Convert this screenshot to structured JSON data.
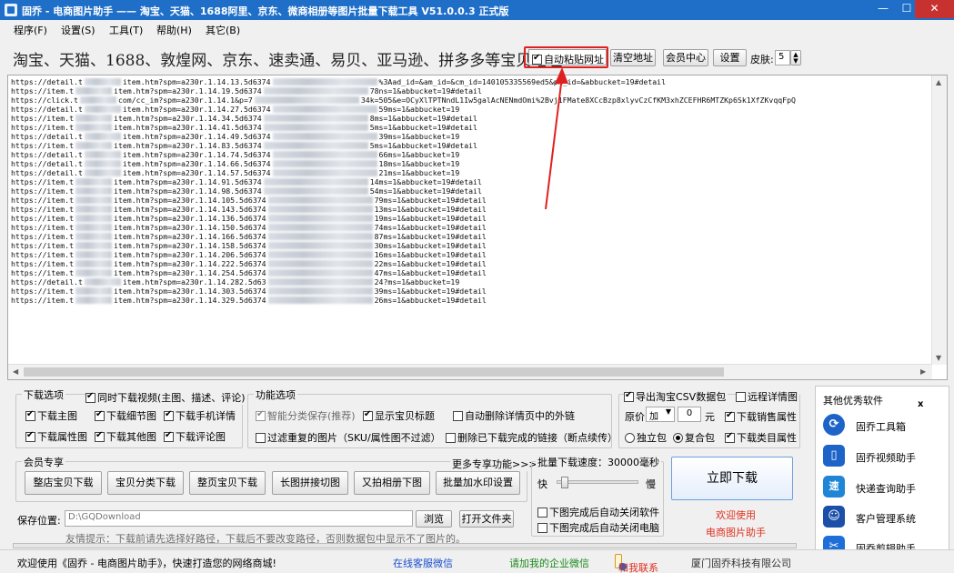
{
  "window": {
    "title": "固乔 - 电商图片助手 —— 淘宝、天猫、1688阿里、京东、微商相册等图片批量下载工具 V51.0.0.3 正式版",
    "min": "—",
    "max": "☐",
    "close": "✕"
  },
  "menu": [
    "程序(F)",
    "设置(S)",
    "工具(T)",
    "帮助(H)",
    "其它(B)"
  ],
  "address": {
    "label": "淘宝、天猫、1688、敦煌网、京东、速卖通、易贝、亚马逊、拼多多等宝贝地址:",
    "auto_paste": "自动粘贴网址",
    "clear": "清空地址",
    "member_center": "会员中心",
    "settings": "设置",
    "skin_label": "皮肤:",
    "skin_value": "5"
  },
  "urls": [
    [
      "https://detail.t",
      "item.htm?spm=a230r.1.14.13.5d6374",
      "%3Aad_id=&am_id=&cm_id=140105335569ed5",
      "&pm_id=&abbucket=19#detail"
    ],
    [
      "https://item.t",
      "item.htm?spm=a230r.1.14.19.5d6374",
      "",
      "78ns=1&abbucket=19#detail"
    ],
    [
      "https://click.t",
      "com/cc_im?spm=a230r.1.14.1&p=7",
      "34k=505&e=OCyXlTPTNndL1Iw5galAcNENmdOmi%2Bvj1FMate8XCcBzp8xly",
      "vCzCfKM3xhZCEFHR6MTZKp6Sk1XfZKvqqFpQ"
    ],
    [
      "https://detail.t",
      "item.htm?spm=a230r.1.14.27.5d6374",
      "",
      "59ms=1&abbucket=19"
    ],
    [
      "https://item.t",
      "item.htm?spm=a230r.1.14.34.5d6374",
      "",
      "8ms=1&abbucket=19#detail"
    ],
    [
      "https://item.t",
      "item.htm?spm=a230r.1.14.41.5d6374",
      "",
      "5ms=1&abbucket=19#detail"
    ],
    [
      "https://detail.t",
      "item.htm?spm=a230r.1.14.49.5d6374",
      "",
      "39ms=1&abbucket=19"
    ],
    [
      "https://item.t",
      "item.htm?spm=a230r.1.14.83.5d6374",
      "",
      "5ms=1&abbucket=19#detail"
    ],
    [
      "https://detail.t",
      "item.htm?spm=a230r.1.14.74.5d6374",
      "",
      "66ms=1&abbucket=19"
    ],
    [
      "https://detail.t",
      "item.htm?spm=a230r.1.14.66.5d6374",
      "",
      "18ms=1&abbucket=19"
    ],
    [
      "https://detail.t",
      "item.htm?spm=a230r.1.14.57.5d6374",
      "",
      "21ms=1&abbucket=19"
    ],
    [
      "https://item.t",
      "item.htm?spm=a230r.1.14.91.5d6374",
      "",
      "14ms=1&abbucket=19#detail"
    ],
    [
      "https://item.t",
      "item.htm?spm=a230r.1.14.98.5d6374",
      "",
      "54ms=1&abbucket=19#detail"
    ],
    [
      "https://item.t",
      "item.htm?spm=a230r.1.14.105.5d6374",
      "",
      "79ms=1&abbucket=19#detail"
    ],
    [
      "https://item.t",
      "item.htm?spm=a230r.1.14.143.5d6374",
      "",
      "13ms=1&abbucket=19#detail"
    ],
    [
      "https://item.t",
      "item.htm?spm=a230r.1.14.136.5d6374",
      "",
      "19ms=1&abbucket=19#detail"
    ],
    [
      "https://item.t",
      "item.htm?spm=a230r.1.14.150.5d6374",
      "",
      "74ms=1&abbucket=19#detail"
    ],
    [
      "https://item.t",
      "item.htm?spm=a230r.1.14.166.5d6374",
      "",
      "87ms=1&abbucket=19#detail"
    ],
    [
      "https://item.t",
      "item.htm?spm=a230r.1.14.158.5d6374",
      "",
      "30ms=1&abbucket=19#detail"
    ],
    [
      "https://item.t",
      "item.htm?spm=a230r.1.14.206.5d6374",
      "",
      "16ms=1&abbucket=19#detail"
    ],
    [
      "https://item.t",
      "item.htm?spm=a230r.1.14.222.5d6374",
      "",
      "22ms=1&abbucket=19#detail"
    ],
    [
      "https://item.t",
      "item.htm?spm=a230r.1.14.254.5d6374",
      "",
      "47ms=1&abbucket=19#detail"
    ],
    [
      "https://detail.t",
      "item.htm?spm=a230r.1.14.282.5d63",
      "",
      "24?ms=1&abbucket=19"
    ],
    [
      "https://item.t",
      "item.htm?spm=a230r.1.14.303.5d6374",
      "",
      "39ms=1&abbucket=19#detail"
    ],
    [
      "https://item.t",
      "item.htm?spm=a230r.1.14.329.5d6374",
      "",
      "26ms=1&abbucket=19#detail"
    ]
  ],
  "download_options": {
    "title": "下载选项",
    "video": "同时下载视频(主图、描述、评论)",
    "main_img": "下载主图",
    "detail_img": "下载细节图",
    "mobile_detail": "下载手机详情",
    "attr_img": "下载属性图",
    "other_img": "下载其他图",
    "review_img": "下载评论图"
  },
  "function_options": {
    "title": "功能选项",
    "smart_classify": "智能分类保存(推荐)",
    "show_title": "显示宝贝标题",
    "auto_delete_links": "自动删除详情页中的外链",
    "filter_dup": "过滤重复的图片（SKU/属性图不过滤）",
    "delete_done": "删除已下载完成的链接（断点续传）"
  },
  "csv_options": {
    "export_csv": "导出淘宝CSV数据包",
    "remote_detail": "远程详情图",
    "price_label": "原价",
    "price_op": "加",
    "price_value": "0",
    "price_unit": "元",
    "sales_attr": "下载销售属性",
    "standalone": "独立包",
    "combined": "复合包",
    "category_attr": "下载类目属性"
  },
  "member": {
    "title": "会员专享",
    "more": "更多专享功能>>>",
    "buttons": [
      "整店宝贝下载",
      "宝贝分类下载",
      "整页宝贝下载",
      "长图拼接切图",
      "又拍相册下图",
      "批量加水印设置"
    ]
  },
  "speed": {
    "label": "批量下载速度：30000毫秒",
    "fast": "快",
    "slow": "慢",
    "value_fraction": 0.05,
    "close_app": "下图完成后自动关闭软件",
    "shutdown": "下图完成后自动关闭电脑"
  },
  "download_now": "立即下载",
  "welcome_line1": "欢迎使用",
  "welcome_line2": "电商图片助手",
  "save": {
    "label": "保存位置:",
    "path": "D:\\GQDownload",
    "browse": "浏览",
    "open_folder": "打开文件夹",
    "tip": "友情提示：下载前请先选择好路径，下载后不要改变路径，否则数据包中显示不了图片的。"
  },
  "other_software": {
    "title": "其他优秀软件",
    "close": "x",
    "items": [
      {
        "label": "固乔工具箱",
        "icon": "⟳"
      },
      {
        "label": "固乔视频助手",
        "icon": "▯"
      },
      {
        "label": "快递查询助手",
        "icon": "速"
      },
      {
        "label": "客户管理系统",
        "icon": "☺"
      },
      {
        "label": "固乔剪辑助手",
        "icon": "✂"
      }
    ]
  },
  "status": {
    "welcome": "欢迎使用《固乔 - 电商图片助手》，快速打造您的网络商城!",
    "service": "在线客服微信",
    "enterprise": "请加我的企业微信",
    "contact": "和我联系",
    "company": "厦门固乔科技有限公司"
  }
}
